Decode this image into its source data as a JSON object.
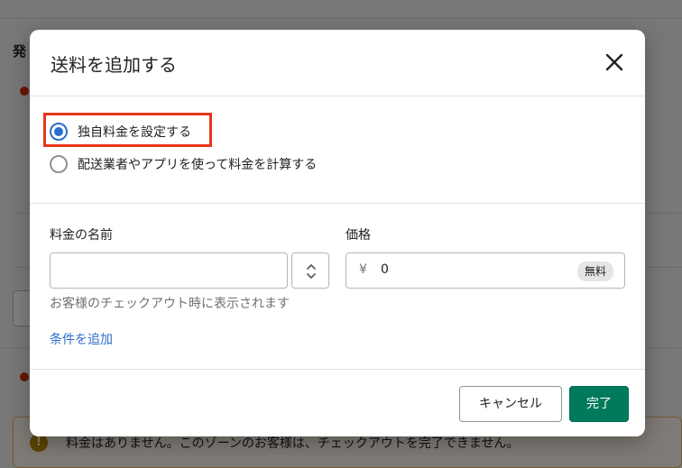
{
  "background": {
    "section_title": "発",
    "banner_text": "料金はありません。このゾーンのお客様は、チェックアウトを完了できません。",
    "banner_icon": "!"
  },
  "modal": {
    "title": "送料を追加する",
    "close_icon": "close-icon",
    "rate_options": [
      {
        "label": "独自料金を設定する",
        "checked": true
      },
      {
        "label": "配送業者やアプリを使って料金を計算する",
        "checked": false
      }
    ],
    "rate_name": {
      "label": "料金の名前",
      "value": "",
      "help": "お客様のチェックアウト時に表示されます"
    },
    "price": {
      "label": "価格",
      "currency_symbol": "¥",
      "value": "0",
      "badge": "無料"
    },
    "add_condition_link": "条件を追加",
    "cancel_label": "キャンセル",
    "done_label": "完了"
  },
  "colors": {
    "primary": "#007a5a",
    "link": "#2c6ecb",
    "highlight": "#e8341c"
  }
}
